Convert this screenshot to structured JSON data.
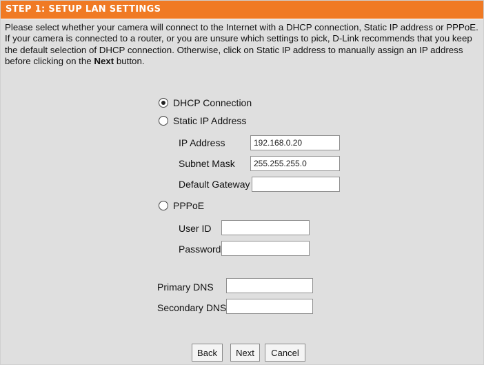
{
  "header": {
    "title": "STEP 1: SETUP LAN SETTINGS"
  },
  "intro": {
    "text_before_bold": "Please select whether your camera will connect to the Internet with a DHCP connection, Static IP address or PPPoE. If your camera is connected to a router, or you are unsure which settings to pick, D-Link recommends that you keep the default selection of DHCP connection. Otherwise, click on Static IP address to manually assign an IP address before clicking on the ",
    "bold": "Next",
    "text_after_bold": " button."
  },
  "connection": {
    "dhcp": {
      "label": "DHCP Connection",
      "selected": true
    },
    "static": {
      "label": "Static IP Address",
      "selected": false,
      "ip_label": "IP Address",
      "ip_value": "192.168.0.20",
      "mask_label": "Subnet Mask",
      "mask_value": "255.255.255.0",
      "gateway_label": "Default Gateway",
      "gateway_value": ""
    },
    "pppoe": {
      "label": "PPPoE",
      "selected": false,
      "user_label": "User ID",
      "user_value": "",
      "password_label": "Password",
      "password_value": ""
    }
  },
  "dns": {
    "primary_label": "Primary DNS",
    "primary_value": "",
    "secondary_label": "Secondary DNS",
    "secondary_value": ""
  },
  "buttons": {
    "back": "Back",
    "next": "Next",
    "cancel": "Cancel"
  }
}
